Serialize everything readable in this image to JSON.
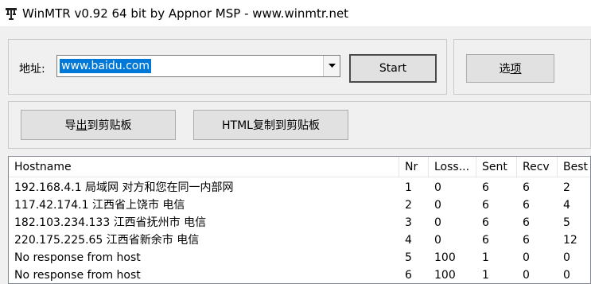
{
  "window": {
    "title": "WinMTR v0.92 64 bit by Appnor MSP - www.winmtr.net"
  },
  "controls": {
    "address_label": "地址:",
    "address_value": "www.baidu.com",
    "start_label": "Start",
    "options_label_pre": "选",
    "options_label_ul": "项",
    "options_label_post": "",
    "export_pre": "导",
    "export_ul": "出",
    "export_post": "到剪贴板",
    "html_copy_label": "HTML复制到剪贴板"
  },
  "table": {
    "columns": [
      "Hostname",
      "Nr",
      "Loss...",
      "Sent",
      "Recv",
      "Best"
    ],
    "rows": [
      [
        "192.168.4.1 局域网 对方和您在同一内部网",
        "1",
        "0",
        "6",
        "6",
        "2"
      ],
      [
        "117.42.174.1 江西省上饶市 电信",
        "2",
        "0",
        "6",
        "6",
        "4"
      ],
      [
        "182.103.234.133 江西省抚州市 电信",
        "3",
        "0",
        "6",
        "6",
        "5"
      ],
      [
        "220.175.225.65 江西省新余市 电信",
        "4",
        "0",
        "6",
        "6",
        "12"
      ],
      [
        "No response from host",
        "5",
        "100",
        "1",
        "0",
        "0"
      ],
      [
        "No response from host",
        "6",
        "100",
        "1",
        "0",
        "0"
      ]
    ]
  }
}
